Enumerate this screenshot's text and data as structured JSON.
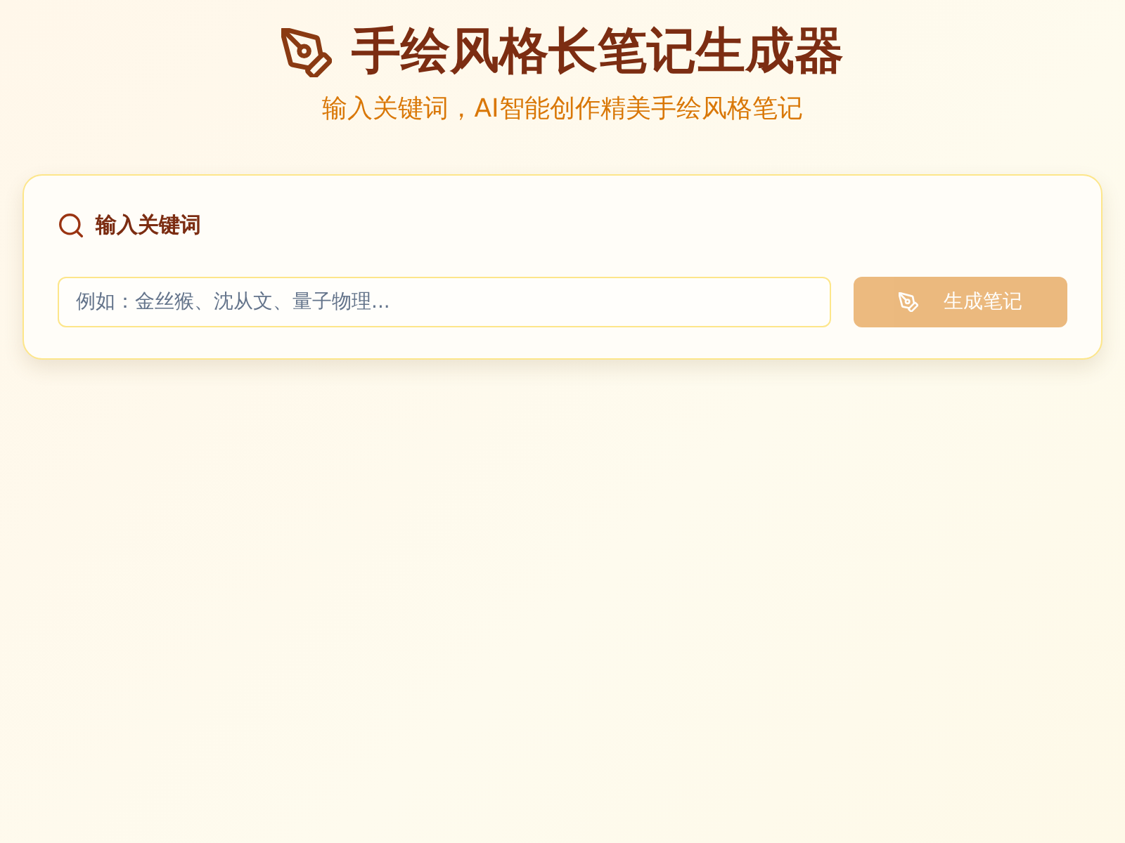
{
  "header": {
    "title": "手绘风格长笔记生成器",
    "subtitle": "输入关键词，AI智能创作精美手绘风格笔记"
  },
  "keyword_panel": {
    "heading": "输入关键词",
    "input": {
      "placeholder": "例如：金丝猴、沈从文、量子物理..."
    },
    "button": {
      "label": "生成笔记",
      "disabled": true
    }
  }
}
